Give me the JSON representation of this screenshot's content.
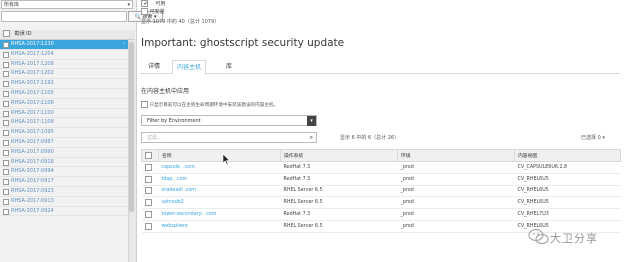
{
  "left_panel": {
    "repo_select": "所有库",
    "search_button": "搜索",
    "header_label": "勘误 ID",
    "advisories": [
      "RHSA-2017:1230",
      "RHSA-2017:1204",
      "RHSA-2017:1208",
      "RHSA-2017:1202",
      "RHSA-2017:1192",
      "RHSA-2017:1105",
      "RHSA-2017:1106",
      "RHSA-2017:1100",
      "RHSA-2017:1108",
      "RHSA-2017:1095",
      "RHSA-2017:0987",
      "RHSA-2017:0990",
      "RHSA-2017:0918",
      "RHSA-2017:0994",
      "RHSA-2017:0917",
      "RHSA-2017:0923",
      "RHSA-2017:0913",
      "RHSA-2017:0924"
    ],
    "selected_index": 0
  },
  "top_bar": {
    "available_label": "可用",
    "installable_label": "可安装",
    "count_text": "显示 1079 中的 40（总计 1079）"
  },
  "main": {
    "title": "Important: ghostscript security update",
    "tabs": [
      {
        "label": "详情",
        "active": false
      },
      {
        "label": "内容主机",
        "active": true
      },
      {
        "label": "库",
        "active": false
      }
    ],
    "section_heading": "在内容主机中应用",
    "only_checkbox_label": "只显示目前可以在主机生命周期环境中安装该勘误的内容主机。",
    "env_select": "Filter by Environment",
    "filter_placeholder": "过滤...",
    "showing_text": "显示 6 中的 6（总计 26）",
    "selected_text": "已选择 0",
    "table": {
      "columns": [
        "名称",
        "操作系统",
        "环境",
        "内容视图"
      ],
      "rows": [
        {
          "name": "capsule.          .com",
          "os": "RedHat 7.3",
          "env": "_prod",
          "view": "CV_CAPSULE6U6.2.8"
        },
        {
          "name": "tdap.          .com",
          "os": "RedHat 7.3",
          "env": "_prod",
          "view": "CV_RHEL6U5"
        },
        {
          "name": "oradeadl          .com",
          "os": "RHEL Server 6.5",
          "env": "_prod",
          "view": "CV_RHEL6U5"
        },
        {
          "name": "satnode2",
          "os": "RHEL Server 6.5",
          "env": "_prod",
          "view": "CV_RHEL6U5"
        },
        {
          "name": "tower-secondary-          .com",
          "os": "RedHat 7.3",
          "env": "_prod",
          "view": "CV_RHEL7U3"
        },
        {
          "name": "websphere",
          "os": "RHEL Server 6.5",
          "env": "_prod",
          "view": "CV_RHEL6U5"
        }
      ]
    }
  },
  "watermark": "大卫分享",
  "colors": {
    "accent": "#39a5dc",
    "panel": "#f2f2f2"
  }
}
